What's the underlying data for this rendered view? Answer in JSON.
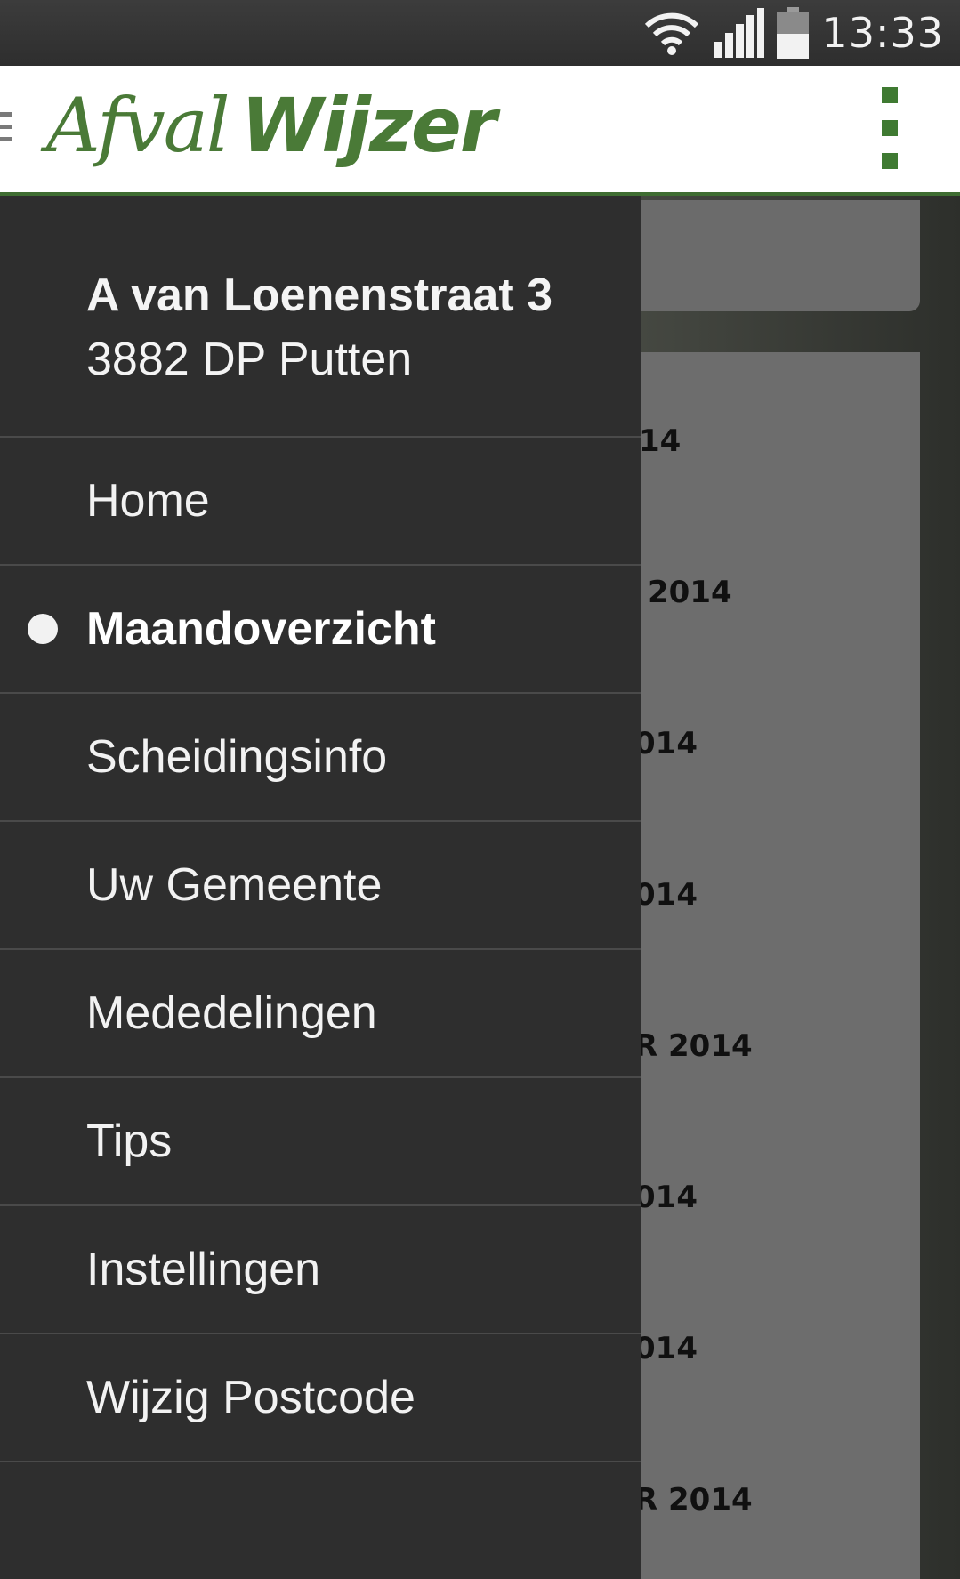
{
  "status_bar": {
    "time": "13:33",
    "icons": [
      "wifi-icon",
      "signal-icon",
      "battery-icon"
    ]
  },
  "action_bar": {
    "logo_part1": "Afval",
    "logo_part2": "Wijzer",
    "brand_color": "#4a7a37",
    "menu_icon": "overflow-menu-icon",
    "drawer_icon": "drawer-toggle-icon"
  },
  "drawer": {
    "address_line1": "A van Loenenstraat 3",
    "address_line2": "3882 DP Putten",
    "items": [
      {
        "label": "Home",
        "active": false
      },
      {
        "label": "Maandoverzicht",
        "active": true
      },
      {
        "label": "Scheidingsinfo",
        "active": false
      },
      {
        "label": "Uw Gemeente",
        "active": false
      },
      {
        "label": "Mededelingen",
        "active": false
      },
      {
        "label": "Tips",
        "active": false
      },
      {
        "label": "Instellingen",
        "active": false
      },
      {
        "label": "Wijzig Postcode",
        "active": false
      }
    ]
  },
  "background_list": {
    "rows": [
      "14",
      "2014",
      "014",
      "014",
      "R 2014",
      "014",
      "014",
      "R 2014"
    ]
  }
}
